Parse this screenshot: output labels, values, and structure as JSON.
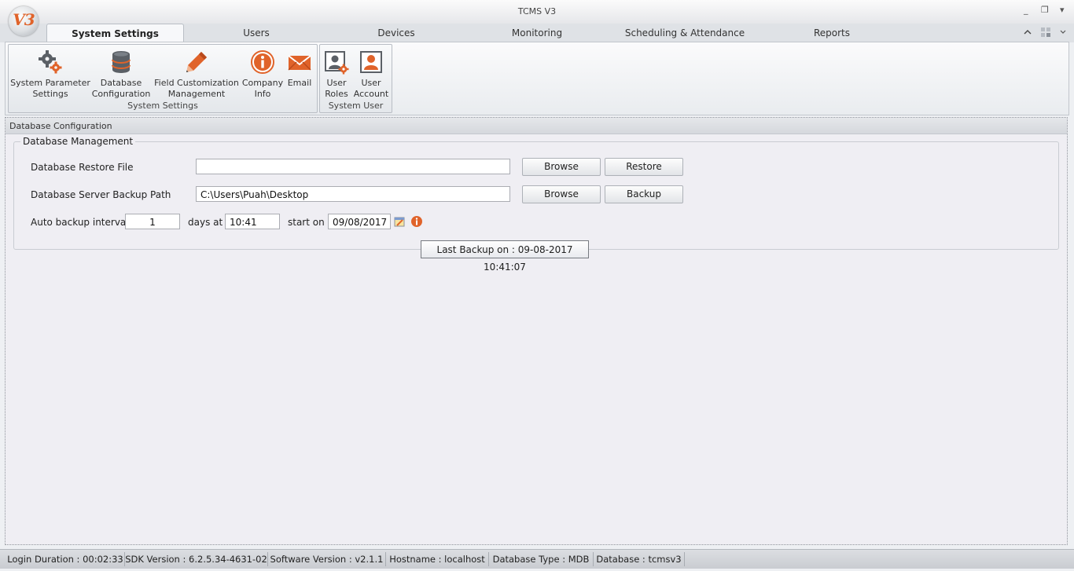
{
  "window": {
    "title": "TCMS V3",
    "logo_text": "V3",
    "controls": {
      "minimize": "_",
      "restore": "❐",
      "close": "▾"
    }
  },
  "tabs": [
    {
      "label": "System Settings",
      "active": true
    },
    {
      "label": "Users"
    },
    {
      "label": "Devices"
    },
    {
      "label": "Monitoring"
    },
    {
      "label": "Scheduling & Attendance"
    },
    {
      "label": "Reports"
    }
  ],
  "ribbon": {
    "groups": [
      {
        "label": "System Settings",
        "buttons": [
          {
            "line1": "System Parameter",
            "line2": "Settings",
            "icon": "gears-icon"
          },
          {
            "line1": "Database",
            "line2": "Configuration",
            "icon": "database-icon"
          },
          {
            "line1": "Field Customization",
            "line2": "Management",
            "icon": "pencil-icon"
          },
          {
            "line1": "Company",
            "line2": "Info",
            "icon": "info-icon"
          },
          {
            "line1": "Email",
            "line2": "",
            "icon": "envelope-icon"
          }
        ]
      },
      {
        "label": "System User",
        "buttons": [
          {
            "line1": "User",
            "line2": "Roles",
            "icon": "user-roles-icon"
          },
          {
            "line1": "User",
            "line2": "Account",
            "icon": "user-account-icon"
          }
        ]
      }
    ]
  },
  "panel": {
    "title": "Database Configuration",
    "groupbox_title": "Database Management",
    "restore": {
      "label": "Database Restore File",
      "value": "",
      "browse_label": "Browse",
      "action_label": "Restore"
    },
    "backup": {
      "label": "Database Server Backup Path",
      "value": "C:\\Users\\Puah\\Desktop",
      "browse_label": "Browse",
      "action_label": "Backup"
    },
    "auto_backup": {
      "label": "Auto backup interval",
      "interval": "1",
      "days_label": "days at",
      "time": "10:41",
      "start_label": "start on",
      "date": "09/08/2017"
    },
    "tooltip": "Last Backup on : 09-08-2017 10:41:07"
  },
  "status_bar": [
    "Login Duration : 00:02:33",
    "SDK Version : 6.2.5.34-4631-02",
    "Software Version : v2.1.1",
    "Hostname : localhost",
    "Database Type : MDB",
    "Database : tcmsv3"
  ],
  "colors": {
    "accent": "#e0632a",
    "icon_gray": "#5b6066"
  }
}
